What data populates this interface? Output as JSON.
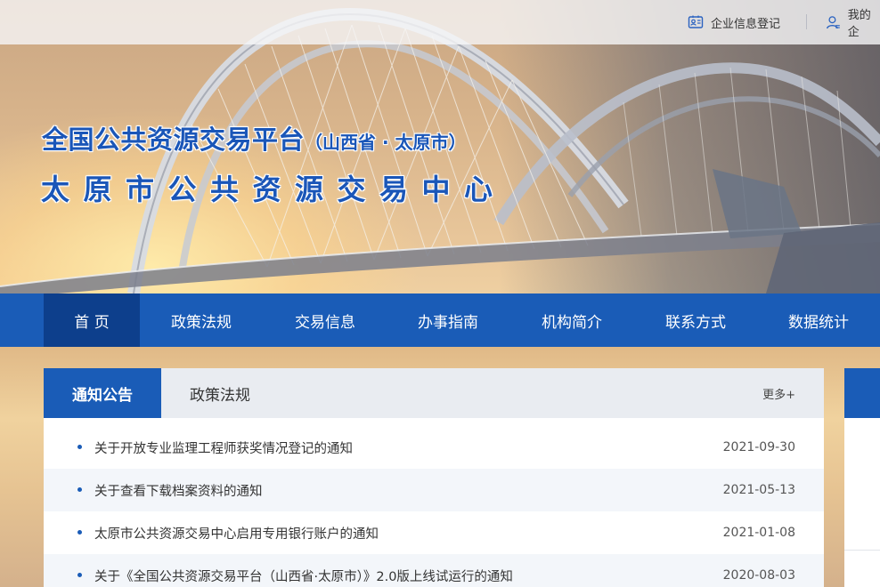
{
  "topbar": {
    "register_label": "企业信息登记",
    "account_label": "我的企"
  },
  "title": {
    "line1_main": "全国公共资源交易平台",
    "line1_sub": "（山西省 · 太原市）",
    "line2": "太原市公共资源交易中心"
  },
  "nav": {
    "items": [
      {
        "label": "首 页"
      },
      {
        "label": "政策法规"
      },
      {
        "label": "交易信息"
      },
      {
        "label": "办事指南"
      },
      {
        "label": "机构简介"
      },
      {
        "label": "联系方式"
      },
      {
        "label": "数据统计"
      }
    ]
  },
  "notice": {
    "tab_active": "通知公告",
    "tab_inactive": "政策法规",
    "more_label": "更多+",
    "rows": [
      {
        "title": "关于开放专业监理工程师获奖情况登记的通知",
        "date": "2021-09-30"
      },
      {
        "title": "关于查看下载档案资料的通知",
        "date": "2021-05-13"
      },
      {
        "title": "太原市公共资源交易中心启用专用银行账户的通知",
        "date": "2021-01-08"
      },
      {
        "title": "关于《全国公共资源交易平台（山西省·太原市）》2.0版上线试运行的通知",
        "date": "2020-08-03"
      }
    ]
  },
  "colors": {
    "brand_blue": "#1a5cb7",
    "nav_active": "#0d3f8c",
    "title_blue": "#1a56b8"
  },
  "icons": [
    "id-card-icon",
    "user-icon",
    "bullet-dot-icon"
  ]
}
